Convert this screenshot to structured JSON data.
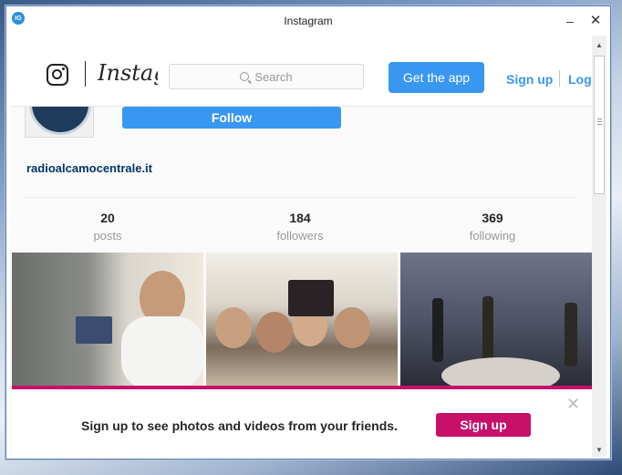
{
  "window": {
    "title": "Instagram"
  },
  "titlebar": {
    "minimize": "–",
    "close": "✕"
  },
  "nav": {
    "wordmark": "Instagram",
    "search_placeholder": "Search",
    "get_app_label": "Get the app",
    "signup_label": "Sign up",
    "login_label": "Log"
  },
  "profile": {
    "follow_label": "Follow",
    "username": "radioalcamocentrale.it",
    "stats": [
      {
        "value": "20",
        "label": "posts"
      },
      {
        "value": "184",
        "label": "followers"
      },
      {
        "value": "369",
        "label": "following"
      }
    ]
  },
  "banner": {
    "text": "Sign up to see photos and videos from your friends.",
    "signup_label": "Sign up",
    "close": "✕"
  },
  "colors": {
    "accent": "#3897f0",
    "banner_accent": "#c8106b",
    "link": "#003569"
  },
  "icons": [
    "app-icon",
    "instagram-glyph-icon",
    "search-icon",
    "close-icon",
    "minimize-icon",
    "scroll-up-icon",
    "scroll-down-icon"
  ]
}
